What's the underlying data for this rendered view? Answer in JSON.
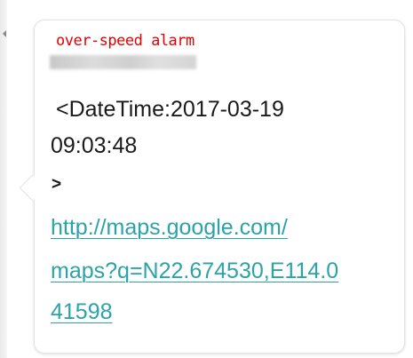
{
  "annotation": "over-speed alarm",
  "message": {
    "datetime_line": "<DateTime:2017-03-19",
    "time_line": "09:03:48",
    "close_line": ">",
    "link_lines": [
      "http://maps.google.com/",
      "maps?q=N22.674530,E114.0",
      "41598"
    ]
  },
  "colors": {
    "annotation": "#e60000",
    "link": "#2aa3a9",
    "text": "#1a1a1a"
  }
}
